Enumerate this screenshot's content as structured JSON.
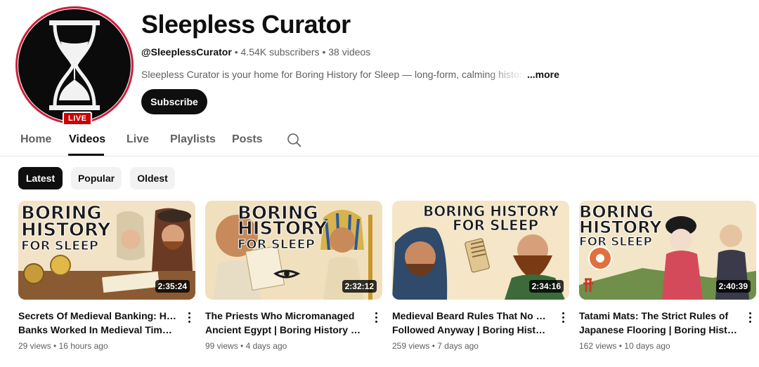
{
  "channel": {
    "name": "Sleepless Curator",
    "handle": "@SleeplessCurator",
    "subscribers": "4.54K subscribers",
    "video_count": "38 videos",
    "separator": "•",
    "description": "Sleepless Curator is your home for Boring History for Sleep — long-form, calming historic",
    "more_label": "...more",
    "live_badge": "LIVE",
    "subscribe_label": "Subscribe",
    "avatar_icon": "hourglass-icon",
    "ring_color": "#cc1f3a"
  },
  "tabs": [
    {
      "label": "Home",
      "active": false
    },
    {
      "label": "Videos",
      "active": true
    },
    {
      "label": "Live",
      "active": false
    },
    {
      "label": "Playlists",
      "active": false
    },
    {
      "label": "Posts",
      "active": false
    }
  ],
  "filters": [
    {
      "label": "Latest",
      "active": true
    },
    {
      "label": "Popular",
      "active": false
    },
    {
      "label": "Oldest",
      "active": false
    }
  ],
  "videos": [
    {
      "title_line1": "Secrets Of Medieval Banking: How",
      "title_line2": "Banks Worked In Medieval Times | Boring History For Sleep",
      "views": "29 views",
      "age": "16 hours ago",
      "duration": "2:35:24",
      "thumb_text": [
        "BORING",
        "HISTORY",
        "FOR SLEEP"
      ]
    },
    {
      "title_line1": "The Priests Who Micromanaged",
      "title_line2": "Ancient Egypt | Boring History For Sleep",
      "views": "99 views",
      "age": "4 days ago",
      "duration": "2:32:12",
      "thumb_text": [
        "BORING",
        "HISTORY",
        "FOR SLEEP"
      ]
    },
    {
      "title_line1": "Medieval Beard Rules That No One",
      "title_line2": "Followed Anyway | Boring History For Sleep",
      "views": "259 views",
      "age": "7 days ago",
      "duration": "2:34:16",
      "thumb_text": [
        "BORING HISTORY",
        "FOR SLEEP"
      ]
    },
    {
      "title_line1": "Tatami Mats: The Strict Rules of",
      "title_line2": "Japanese Flooring | Boring History For Sleep",
      "views": "162 views",
      "age": "10 days ago",
      "duration": "2:40:39",
      "thumb_text": [
        "BORING",
        "HISTORY",
        "FOR SLEEP"
      ]
    }
  ]
}
